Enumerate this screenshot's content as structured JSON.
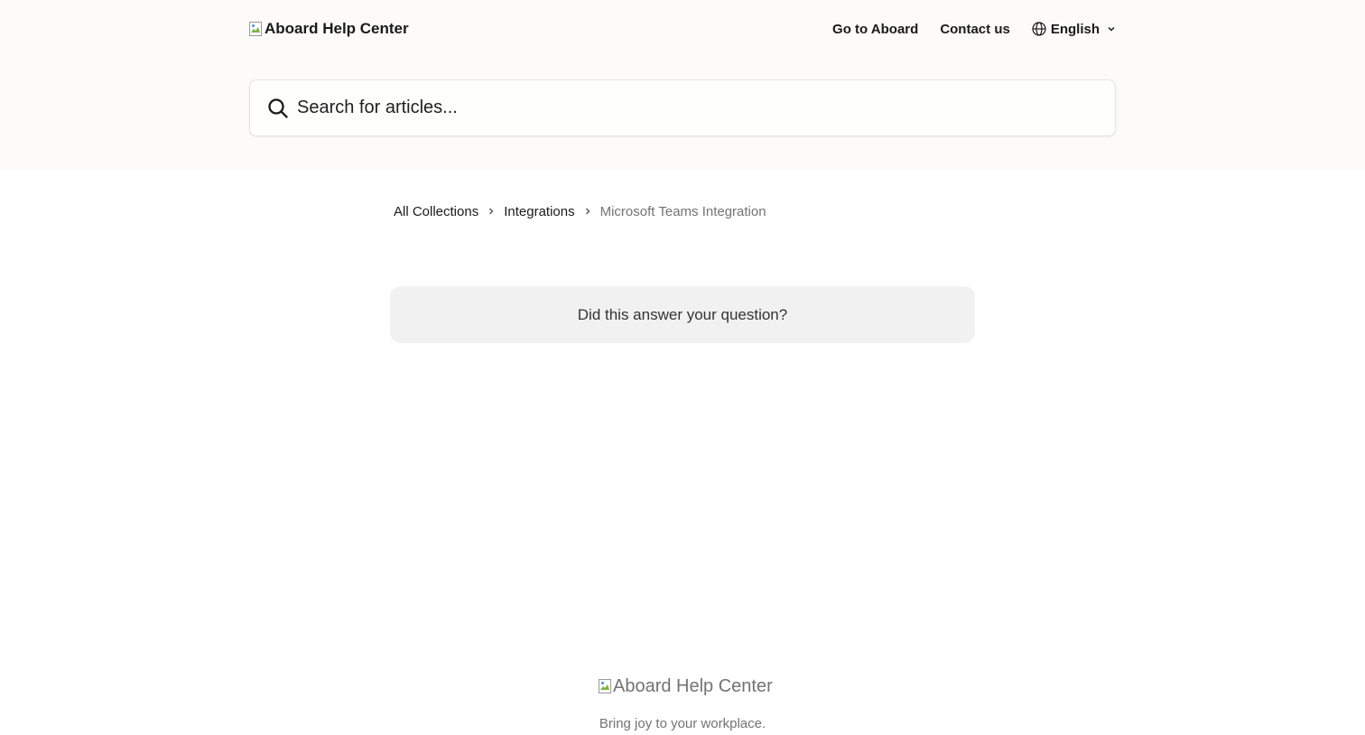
{
  "header": {
    "logo_alt": "Aboard Help Center",
    "nav": {
      "go_to": "Go to Aboard",
      "contact": "Contact us",
      "language": "English"
    },
    "icons": {
      "globe": "globe-icon",
      "chevron": "chevron-down-icon"
    }
  },
  "search": {
    "placeholder": "Search for articles...",
    "icon": "search-icon"
  },
  "breadcrumb": {
    "items": [
      "All Collections",
      "Integrations"
    ],
    "current": "Microsoft Teams Integration"
  },
  "feedback": {
    "question": "Did this answer your question?"
  },
  "footer": {
    "logo_alt": "Aboard Help Center",
    "tagline": "Bring joy to your workplace."
  },
  "colors": {
    "header_bg": "#fcfbfa",
    "feedback_bg": "#f1f1f1",
    "muted_text": "#737373"
  }
}
